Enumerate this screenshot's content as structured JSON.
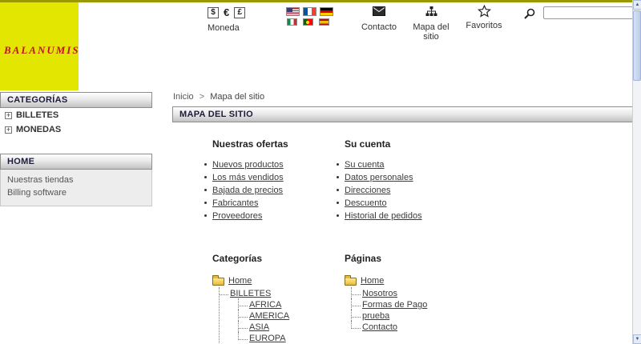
{
  "colors": {
    "top_bar": "#9A9A00",
    "logo_bg": "#E3E600",
    "logo_text": "#C01420",
    "header_bar_text": "#1B1B3C",
    "link": "#3B3B3B"
  },
  "header": {
    "logo": "BALANUMIS",
    "currency": {
      "label": "Moneda",
      "dollar": "$",
      "euro": "€",
      "pound": "£"
    },
    "flags": [
      "us-flag",
      "france-flag",
      "germany-flag",
      "italy-flag",
      "portugal-flag",
      "spain-flag"
    ],
    "contact": "Contacto",
    "sitemap": "Mapa del sitio",
    "favorites": "Favoritos",
    "search_value": ""
  },
  "sidebar": {
    "categories": {
      "title": "CATEGORÍAS",
      "items": [
        {
          "label": "BILLETES"
        },
        {
          "label": "MONEDAS"
        }
      ]
    },
    "home": {
      "title": "HOME",
      "items": [
        {
          "label": "Nuestras tiendas"
        },
        {
          "label": "Billing software"
        }
      ]
    }
  },
  "main": {
    "breadcrumb": {
      "home": "Inicio",
      "separator": ">",
      "current": "Mapa del sitio"
    },
    "page_title": "MAPA DEL SITIO",
    "offers": {
      "title": "Nuestras ofertas",
      "links": [
        "Nuevos productos",
        "Los más vendidos",
        "Bajada de precios",
        "Fabricantes",
        "Proveedores"
      ]
    },
    "account": {
      "title": "Su cuenta",
      "links": [
        "Su cuenta",
        "Datos personales",
        "Direcciones",
        "Descuento",
        "Historial de pedidos"
      ]
    },
    "categories_tree": {
      "title": "Categorías",
      "root": "Home",
      "branch": "BILLETES",
      "leaves": [
        "AFRICA",
        "AMERICA",
        "ASIA",
        "EUROPA"
      ]
    },
    "pages_tree": {
      "title": "Páginas",
      "root": "Home",
      "leaves": [
        "Nosotros",
        "Formas de Pago",
        "prueba",
        "Contacto"
      ]
    }
  }
}
